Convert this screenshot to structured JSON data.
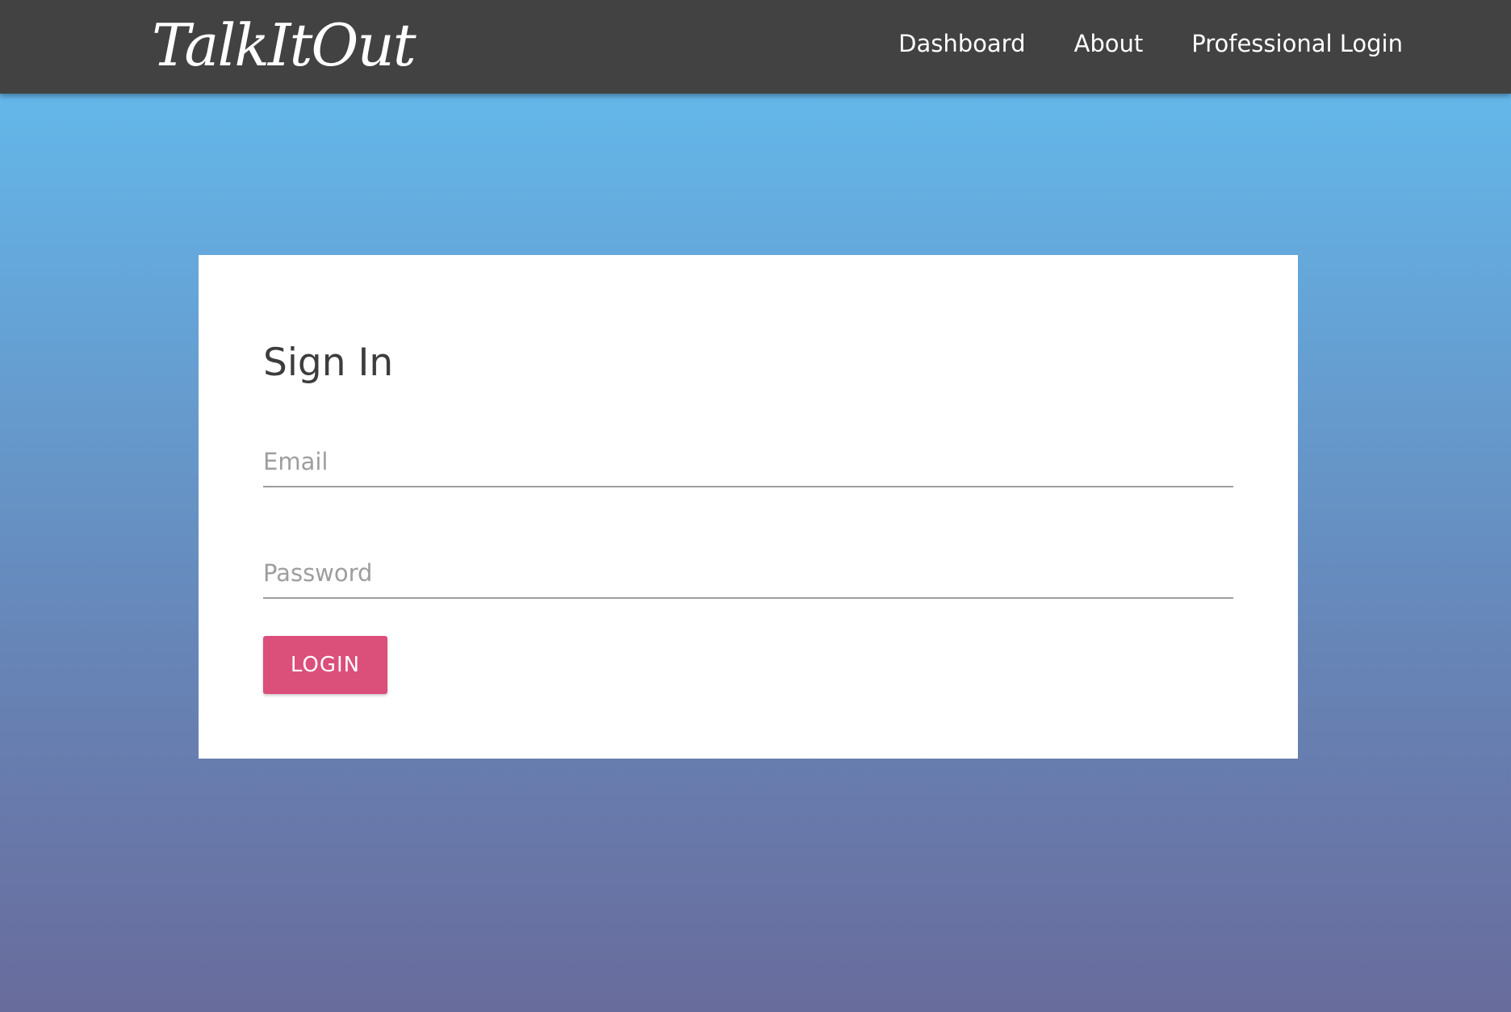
{
  "navbar": {
    "brand": "TalkItOut",
    "links": [
      "Dashboard",
      "About",
      "Professional Login"
    ]
  },
  "signin": {
    "title": "Sign In",
    "email_placeholder": "Email",
    "email_value": "",
    "password_placeholder": "Password",
    "password_value": "",
    "login_label": "LOGIN"
  },
  "colors": {
    "navbar": "#424242",
    "gradient_top": "#64c0f2",
    "gradient_bottom": "#686c9c",
    "login_button": "#db4f7b"
  }
}
